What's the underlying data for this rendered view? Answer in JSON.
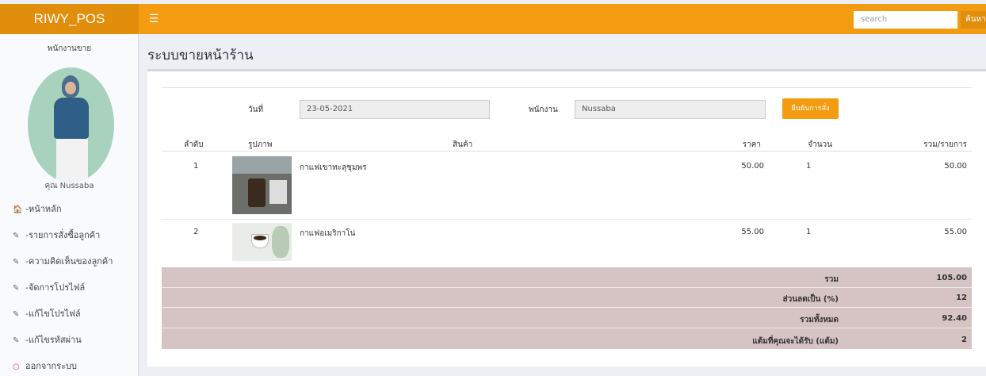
{
  "topbar": {
    "brand": "RIWY_POS",
    "toggle_icon": "☰",
    "search_placeholder": "search",
    "search_button": "ค้นหา"
  },
  "sidebar": {
    "role": "พนักงานขาย",
    "user": "คุณ Nussaba",
    "menu": [
      {
        "icon": "home-icon",
        "glyph": "🏠",
        "label": "-หน้าหลัก"
      },
      {
        "icon": "edit-icon",
        "glyph": "✎",
        "label": "-รายการสั่งซื้อลูกค้า"
      },
      {
        "icon": "edit-icon",
        "glyph": "✎",
        "label": "-ความคิดเห็นของลูกค้า"
      },
      {
        "icon": "edit-icon",
        "glyph": "✎",
        "label": "-จัดการโปรไฟล์"
      },
      {
        "icon": "edit-icon",
        "glyph": "✎",
        "label": "-แก้ไขโปรไฟล์"
      },
      {
        "icon": "edit-icon",
        "glyph": "✎",
        "label": "-แก้ไขรหัสผ่าน"
      },
      {
        "icon": "circle-icon",
        "glyph": "○",
        "label": "ออกจากระบบ"
      }
    ]
  },
  "page": {
    "title": "ระบบขายหน้าร้าน"
  },
  "form": {
    "date_label": "วันที่",
    "date_value": "23-05-2021",
    "staff_label": "พนักงาน",
    "staff_value": "Nussaba",
    "confirm_button": "ยืนยันการสั่ง"
  },
  "table": {
    "headers": [
      "ลำดับ",
      "รูปภาพ",
      "สินค้า",
      "ราคา",
      "จำนวน",
      "รวม/รายการ"
    ],
    "rows": [
      {
        "no": "1",
        "product": "กาแฟเขาทะลุชุมพร",
        "price": "50.00",
        "qty": "1",
        "total": "50.00"
      },
      {
        "no": "2",
        "product": "กาแฟอเมริกาโน่",
        "price": "55.00",
        "qty": "1",
        "total": "55.00"
      }
    ]
  },
  "summary": [
    {
      "label": "รวม",
      "value": "105.00"
    },
    {
      "label": "ส่วนลดเป็น (%)",
      "value": "12"
    },
    {
      "label": "รวมทั้งหมด",
      "value": "92.40"
    },
    {
      "label": "แต้มที่คุณจะได้รับ (แต้ม)",
      "value": "2"
    }
  ],
  "colors": {
    "accent": "#f39c12",
    "summary_bg": "#d6c3c3"
  }
}
